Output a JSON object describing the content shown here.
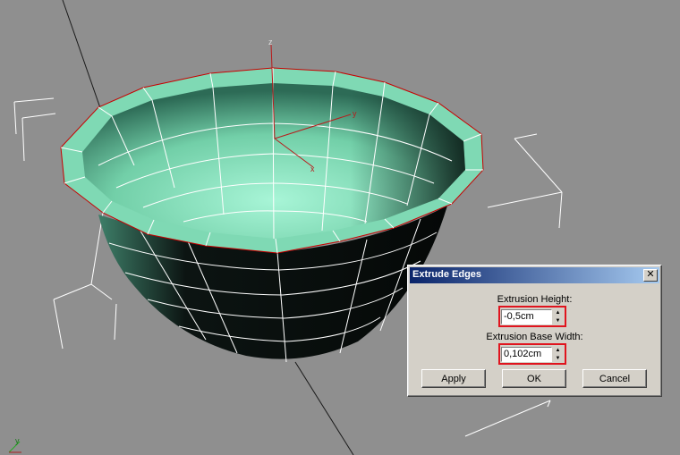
{
  "viewport": {
    "axis_labels": [
      "z",
      "y",
      "x"
    ]
  },
  "dialog": {
    "title": "Extrude Edges",
    "close_glyph": "✕",
    "extrusion_height": {
      "label": "Extrusion Height:",
      "value": "-0,5cm"
    },
    "extrusion_base_width": {
      "label": "Extrusion Base Width:",
      "value": "0,102cm"
    },
    "buttons": {
      "apply": "Apply",
      "ok": "OK",
      "cancel": "Cancel"
    }
  },
  "colors": {
    "bowl_inner": "#7fd9b4",
    "bowl_outer": "#121a17",
    "highlight": "#e0141e",
    "selection_edge": "#c80000"
  }
}
